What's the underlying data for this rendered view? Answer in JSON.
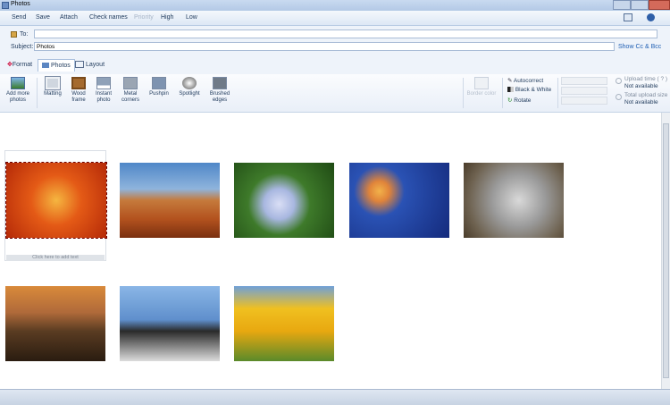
{
  "window": {
    "title": "Photos"
  },
  "menu": {
    "send": "Send",
    "save": "Save",
    "attach": "Attach",
    "check_names": "Check names",
    "priority": "Priority",
    "high": "High",
    "low": "Low"
  },
  "fields": {
    "to_label": "To:",
    "to_value": "",
    "subject_label": "Subject:",
    "subject_value": "Photos",
    "show_cc_bcc": "Show Cc & Bcc"
  },
  "tabs": {
    "format": "Format",
    "photos": "Photos",
    "layout": "Layout"
  },
  "ribbon": {
    "add_more": "Add more photos",
    "frames": [
      {
        "label": "Matting"
      },
      {
        "label": "Wood frame"
      },
      {
        "label": "Instant photo"
      },
      {
        "label": "Metal corners"
      },
      {
        "label": "Pushpin"
      },
      {
        "label": "Spotlight"
      },
      {
        "label": "Brushed edges"
      }
    ],
    "border_color": "Border color",
    "autocorrect": "Autocorrect",
    "black_white": "Black & White",
    "rotate": "Rotate",
    "upload_time_label": "Upload time ( ? )",
    "upload_time_value": "Not available",
    "total_upload_label": "Total upload size",
    "total_upload_value": "Not available"
  },
  "photos": {
    "caption_placeholder": "Click here to add text",
    "colors": {
      "flower": "#e0501a",
      "desert": "#c1602a",
      "hydrangea": "#5a8a3a",
      "jellyfish": "#1e3c8c",
      "koala": "#9a9a9a",
      "lighthouse": "#6a4a2a",
      "penguins": "#4a78b8",
      "tulips": "#e8b820"
    }
  }
}
